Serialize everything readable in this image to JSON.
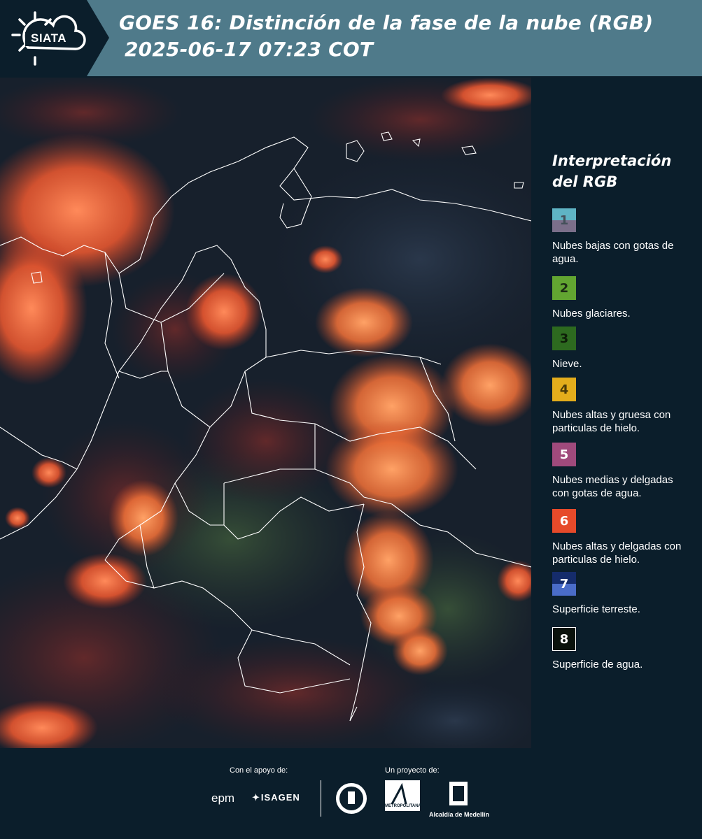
{
  "header": {
    "logo_text": "SIATA",
    "title_line1": "GOES 16: Distinción de la fase de la nube (RGB)",
    "title_line2": "2025-06-17 07:23 COT"
  },
  "legend": {
    "title_line1": "Interpretación",
    "title_line2": "del RGB",
    "items": [
      {
        "number": "1",
        "label": "Nubes bajas con gotas de agua.",
        "color_top": "#5fb4c4",
        "color_bottom": "#7b6f8a",
        "text_color": "#44505a"
      },
      {
        "number": "2",
        "label": "Nubes glaciares.",
        "color_top": "#62a531",
        "color_bottom": "#62a531",
        "text_color": "#1c2a14"
      },
      {
        "number": "3",
        "label": "Nieve.",
        "color_top": "#2d6a1f",
        "color_bottom": "#2d6a1f",
        "text_color": "#0e1e08"
      },
      {
        "number": "4",
        "label": "Nubes altas y gruesa con particulas de hielo.",
        "color_top": "#e3ad1c",
        "color_bottom": "#e3ad1c",
        "text_color": "#4a3a08"
      },
      {
        "number": "5",
        "label": "Nubes medias y delgadas con gotas de agua.",
        "color_top": "#a04a7c",
        "color_bottom": "#a04a7c",
        "text_color": "#ffffff"
      },
      {
        "number": "6",
        "label": "Nubes altas y delgadas con particulas de hielo.",
        "color_top": "#e64a2a",
        "color_bottom": "#e64a2a",
        "text_color": "#ffffff"
      },
      {
        "number": "7",
        "label": "Superficie terreste.",
        "color_top": "#152c6b",
        "color_bottom": "#4a6cc8",
        "text_color": "#ffffff"
      },
      {
        "number": "8",
        "label": "Superficie de agua.",
        "color_top": "#0a120c",
        "color_bottom": "#0a120c",
        "text_color": "#ffffff",
        "border": "#ffffff"
      }
    ]
  },
  "footer": {
    "support_label": "Con el apoyo de:",
    "project_label": "Un proyecto de:",
    "sponsors": [
      "epm",
      "ISAGEN"
    ],
    "partner_captions": [
      "METROPOLITANA",
      "Alcaldía de Medellín"
    ]
  }
}
